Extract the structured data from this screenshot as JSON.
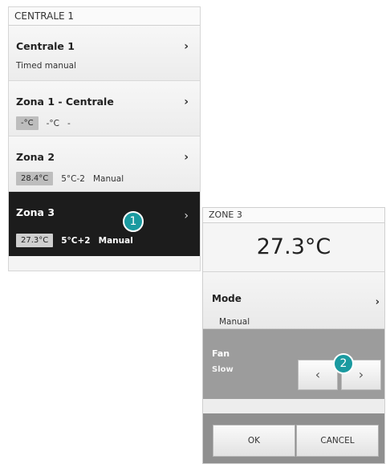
{
  "left_panel": {
    "header": "CENTRALE 1",
    "rows": [
      {
        "title": "Centrale 1",
        "sub": "Timed manual"
      },
      {
        "title": "Zona 1 - Centrale",
        "pill": "-°C",
        "v1": "-°C",
        "v2": "-"
      },
      {
        "title": "Zona 2",
        "pill": "28.4°C",
        "v1": "5°C-2",
        "v2": "Manual"
      },
      {
        "title": "Zona 3",
        "pill": "27.3°C",
        "v1": "5°C+2",
        "v2": "Manual"
      }
    ],
    "chevron": "›"
  },
  "right_panel": {
    "header": "ZONE 3",
    "temperature": "27.3°C",
    "mode": {
      "label": "Mode",
      "value": "Manual"
    },
    "fan": {
      "label": "Fan",
      "value": "Slow",
      "prev": "‹",
      "next": "›"
    },
    "ok_label": "OK",
    "cancel_label": "CANCEL",
    "chevron": "›"
  },
  "badges": {
    "one": "1",
    "two": "2"
  },
  "colors": {
    "badge": "#1a9aa0",
    "selected_row": "#1c1c1c",
    "fan_bg": "#9c9c9c"
  }
}
